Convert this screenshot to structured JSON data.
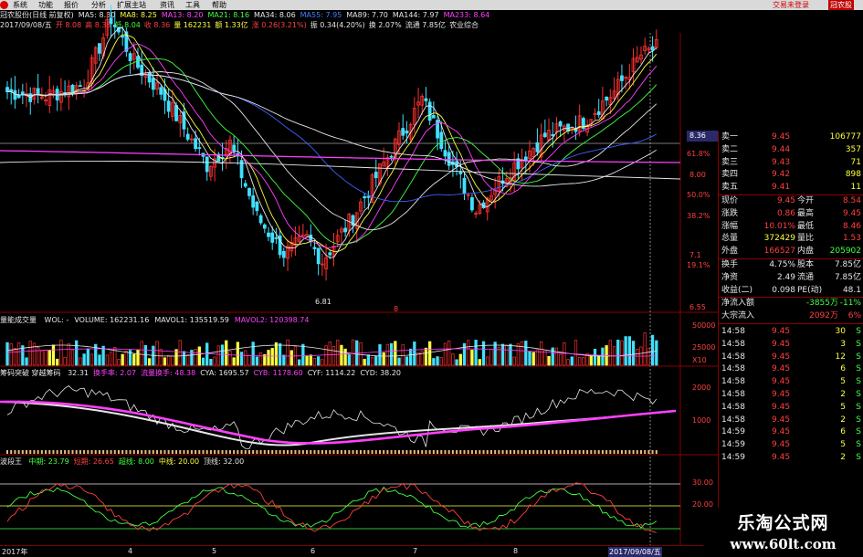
{
  "menu": {
    "items": [
      "系统",
      "功能",
      "报价",
      "分析",
      "扩展主站",
      "资讯",
      "工具",
      "帮助"
    ],
    "trade_login": "交易未登录",
    "stock_tag": "冠农股"
  },
  "header": {
    "line1": [
      {
        "t": "冠农股份(日线 前复权)",
        "c": "#e6e6e6"
      },
      {
        "t": "MA5: 8.30",
        "c": "#e6e6e6"
      },
      {
        "t": "MA8: 8.25",
        "c": "#ffff40"
      },
      {
        "t": "MA13: 8.20",
        "c": "#ff40ff"
      },
      {
        "t": "MA21: 8.16",
        "c": "#40ff40"
      },
      {
        "t": "MA34: 8.06",
        "c": "#e6e6e6"
      },
      {
        "t": "MA55: 7.95",
        "c": "#4080ff"
      },
      {
        "t": "MA89: 7.70",
        "c": "#e6e6e6"
      },
      {
        "t": "MA144: 7.97",
        "c": "#e6e6e6"
      },
      {
        "t": "MA233: 8.64",
        "c": "#ff40ff"
      }
    ],
    "line2": [
      {
        "t": "2017/09/08/五",
        "c": "#e6e6e6"
      },
      {
        "t": "开 8.08",
        "c": "#ff4040"
      },
      {
        "t": "高 8.38",
        "c": "#ff4040"
      },
      {
        "t": "低 8.04",
        "c": "#40ff40"
      },
      {
        "t": "收 8.36",
        "c": "#ff4040"
      },
      {
        "t": "量 162231",
        "c": "#ffff40"
      },
      {
        "t": "额 1.33亿",
        "c": "#ffff40"
      },
      {
        "t": "涨 0.26(3.21%)",
        "c": "#ff4040"
      },
      {
        "t": "振 0.34(4.20%)",
        "c": "#e6e6e6"
      },
      {
        "t": "换 2.07%",
        "c": "#e6e6e6"
      },
      {
        "t": "流通 7.85亿",
        "c": "#e6e6e6"
      },
      {
        "t": "农业综合",
        "c": "#e6e6e6"
      }
    ]
  },
  "price_axis": [
    "8.36",
    "61.8%",
    "8.00",
    "50.0%",
    "38.2%",
    "7.1",
    "19.1%",
    "6.55"
  ],
  "main_chart": {
    "low_marker": "6.81",
    "mid_marker": "8"
  },
  "volume_panel": {
    "title": "量能成交量",
    "fields": [
      {
        "t": "WOL: -",
        "c": "#e6e6e6"
      },
      {
        "t": "VOLUME: 162231.16",
        "c": "#e6e6e6"
      },
      {
        "t": "MAVOL1: 135519.59",
        "c": "#e6e6e6"
      },
      {
        "t": "MAVOL2: 120398.74",
        "c": "#ff40ff"
      }
    ],
    "axis": [
      "50000",
      "25000",
      "X10"
    ]
  },
  "chip_panel": {
    "title": "筹码突破 穿越筹码",
    "fields": [
      {
        "t": "32.31",
        "c": "#e6e6e6"
      },
      {
        "t": "换手率: 2.07",
        "c": "#ff40ff"
      },
      {
        "t": "流量换手: 48.38",
        "c": "#ff40ff"
      },
      {
        "t": "CYA: 1695.57",
        "c": "#e6e6e6"
      },
      {
        "t": "CYB: 1178.60",
        "c": "#ff40ff"
      },
      {
        "t": "CYF: 1114.22",
        "c": "#e6e6e6"
      },
      {
        "t": "CYD: 38.20",
        "c": "#e6e6e6"
      }
    ],
    "axis": [
      "2000",
      "1000"
    ]
  },
  "swing_panel": {
    "title": "波段王",
    "fields": [
      {
        "t": "中期: 23.79",
        "c": "#40ff40"
      },
      {
        "t": "短期: 26.65",
        "c": "#ff4040"
      },
      {
        "t": "超线: 8.00",
        "c": "#40ff40"
      },
      {
        "t": "中线: 20.00",
        "c": "#ffff40"
      },
      {
        "t": "顶线: 32.00",
        "c": "#e6e6e6"
      }
    ],
    "axis": [
      "30.00",
      "20.00"
    ]
  },
  "x_axis": {
    "start": "2017年",
    "months": [
      "4",
      "5",
      "6",
      "7",
      "8"
    ],
    "end_date": "2017/09/08/五"
  },
  "quote": {
    "asks": [
      {
        "label": "卖一",
        "price": "9.45",
        "vol": "106777"
      },
      {
        "label": "卖二",
        "price": "9.44",
        "vol": "357"
      },
      {
        "label": "卖三",
        "price": "9.43",
        "vol": "71"
      },
      {
        "label": "卖四",
        "price": "9.42",
        "vol": "898"
      },
      {
        "label": "卖五",
        "price": "9.41",
        "vol": "11"
      }
    ],
    "stats": [
      {
        "l1": "现价",
        "v1": "9.45",
        "c1": "red",
        "l2": "今开",
        "v2": "8.54",
        "c2": "red"
      },
      {
        "l1": "涨跌",
        "v1": "0.86",
        "c1": "red",
        "l2": "最高",
        "v2": "9.45",
        "c2": "red"
      },
      {
        "l1": "涨幅",
        "v1": "10.01%",
        "c1": "red",
        "l2": "最低",
        "v2": "8.46",
        "c2": "red"
      },
      {
        "l1": "总量",
        "v1": "372429",
        "c1": "yel",
        "l2": "量比",
        "v2": "1.53",
        "c2": "red"
      },
      {
        "l1": "外盘",
        "v1": "166527",
        "c1": "red",
        "l2": "内盘",
        "v2": "205902",
        "c2": "grn"
      }
    ],
    "stats2": [
      {
        "l1": "换手",
        "v1": "4.75%",
        "c1": "wht",
        "l2": "股本",
        "v2": "7.85亿",
        "c2": "wht"
      },
      {
        "l1": "净资",
        "v1": "2.49",
        "c1": "wht",
        "l2": "流通",
        "v2": "7.85亿",
        "c2": "wht"
      },
      {
        "l1": "收益(二)",
        "v1": "0.098",
        "c1": "wht",
        "l2": "PE(动)",
        "v2": "48.1",
        "c2": "wht"
      }
    ],
    "flow": [
      {
        "label": "净流入额",
        "val": "-3855万",
        "pct": "-11%",
        "c": "grn"
      },
      {
        "label": "大宗流入",
        "val": "2092万",
        "pct": "6%",
        "c": "red"
      }
    ],
    "ticks": [
      {
        "time": "14:58",
        "price": "9.45",
        "vol": "30",
        "side": "S"
      },
      {
        "time": "14:58",
        "price": "9.45",
        "vol": "3",
        "side": "S"
      },
      {
        "time": "14:58",
        "price": "9.45",
        "vol": "12",
        "side": "S"
      },
      {
        "time": "14:58",
        "price": "9.45",
        "vol": "6",
        "side": "S"
      },
      {
        "time": "14:58",
        "price": "9.45",
        "vol": "5",
        "side": "S"
      },
      {
        "time": "14:58",
        "price": "9.45",
        "vol": "2",
        "side": "S"
      },
      {
        "time": "14:58",
        "price": "9.45",
        "vol": "5",
        "side": "S"
      },
      {
        "time": "14:58",
        "price": "9.45",
        "vol": "2",
        "side": "S"
      },
      {
        "time": "14:59",
        "price": "9.45",
        "vol": "6",
        "side": "S"
      },
      {
        "time": "14:59",
        "price": "9.45",
        "vol": "5",
        "side": "S"
      },
      {
        "time": "14:59",
        "price": "9.45",
        "vol": "2",
        "side": "S"
      }
    ]
  },
  "watermark": {
    "title": "乐淘公式网",
    "url": "www.60lt.com"
  }
}
